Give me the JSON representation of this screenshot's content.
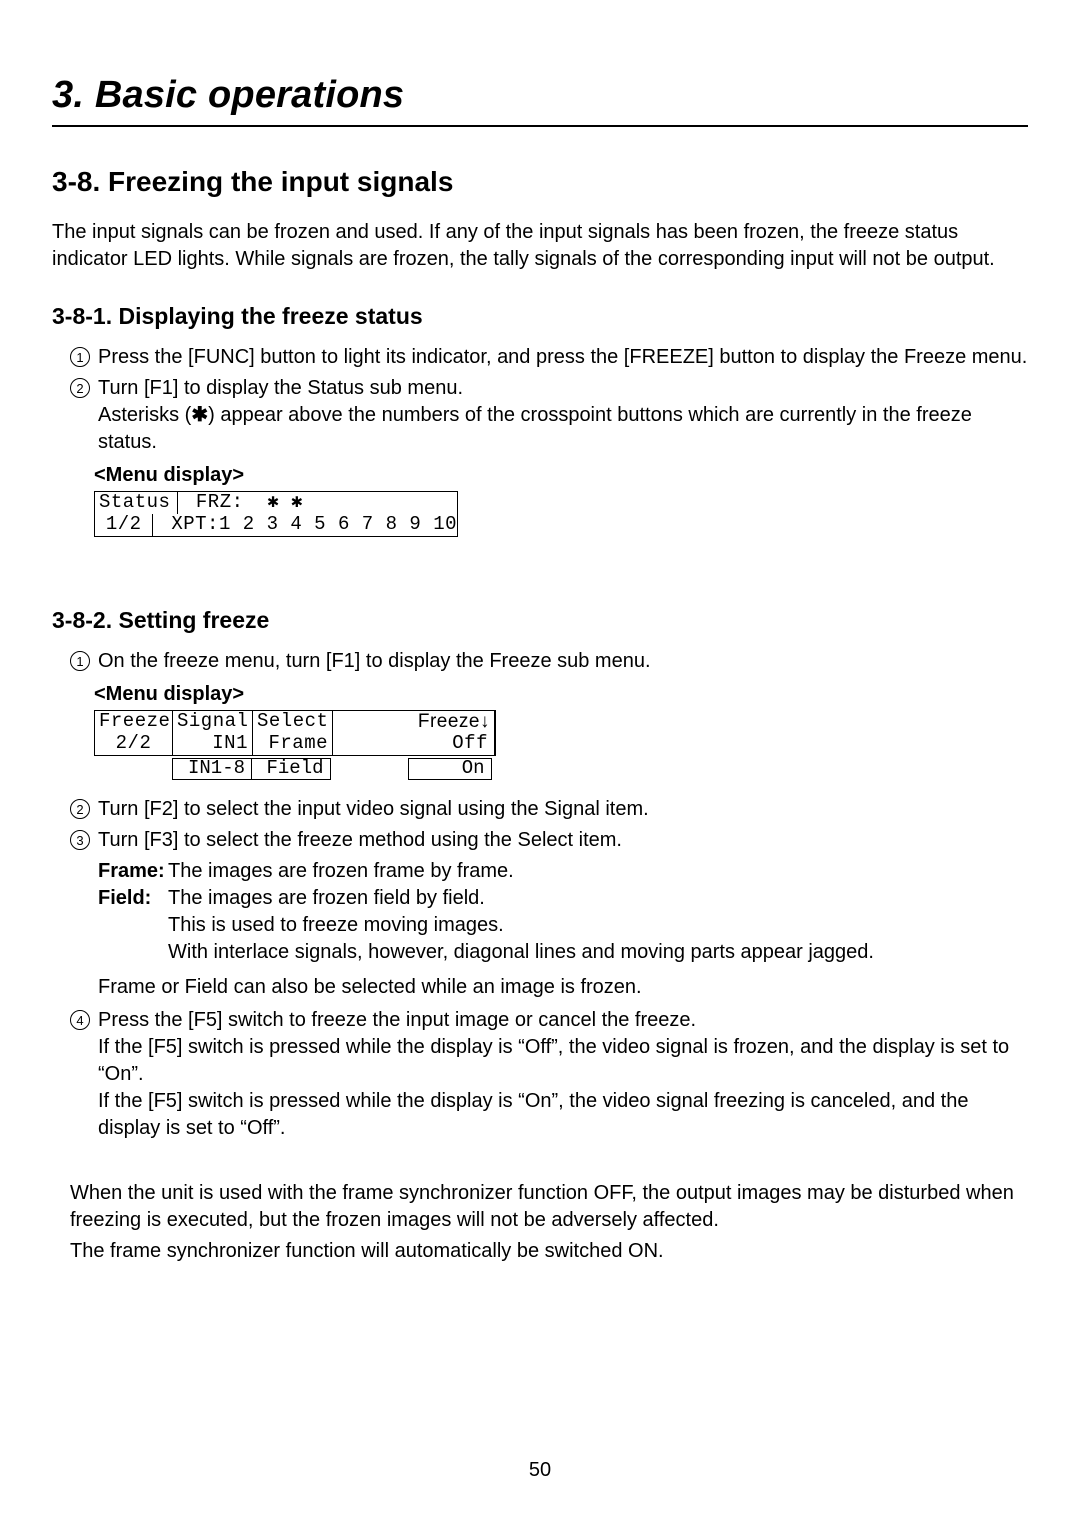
{
  "chapter_title": "3. Basic operations",
  "section_title": "3-8. Freezing the input signals",
  "intro_p1": "The input signals can be frozen and used. If any of the input signals has been frozen, the freeze status indicator LED lights. While signals are frozen, the tally signals of the corresponding input will not be output.",
  "sub1_title": "3-8-1. Displaying the freeze status",
  "sub1_step1": "Press the [FUNC] button to light its indicator, and press the [FREEZE] button to display the Freeze menu.",
  "sub1_step2a": "Turn [F1] to display the Status sub menu.",
  "sub1_step2b_pre": "Asterisks (",
  "sub1_step2b_ast": "✱",
  "sub1_step2b_post": ") appear above the numbers of the crosspoint buttons which are currently in the freeze status.",
  "menu_display_label": "<Menu display>",
  "menu1": {
    "r1_left": "Status",
    "r1_right": " FRZ:  ✱ ✱",
    "r2_left": "1/2",
    "r2_right": " XPT:1 2 3 4 5 6 7 8 9 10"
  },
  "sub2_title": "3-8-2. Setting freeze",
  "sub2_step1": "On the freeze menu, turn [F1] to display the Freeze sub menu.",
  "menu2": {
    "h_c1": "Freeze",
    "h_c2": "Signal",
    "h_c3": "Select",
    "h_c4": "Freeze↓",
    "v_c1": "2/2",
    "v_c2": "IN1",
    "v_c3": "Frame",
    "v_c4": "Off",
    "o_sig": "IN1-8",
    "o_sel": "Field",
    "o_frz": "On"
  },
  "sub2_step2": "Turn [F2] to select the input video signal using the Signal item.",
  "sub2_step3": "Turn [F3] to select the freeze method using the Select item.",
  "def_frame_term": "Frame:",
  "def_frame_def": "The images are frozen frame by frame.",
  "def_field_term": "Field:",
  "def_field_def1": "The images are frozen field by field.",
  "def_field_def2": "This is used to freeze moving images.",
  "def_field_def3": "With interlace signals, however, diagonal lines and moving parts appear jagged.",
  "sub2_note1": "Frame or Field can also be selected while an image is frozen.",
  "sub2_step4a": "Press the [F5] switch to freeze the input image or cancel the freeze.",
  "sub2_step4b": "If the [F5] switch is pressed while the display is “Off”, the video signal is frozen, and the display is set to “On”.",
  "sub2_step4c": "If the [F5] switch is pressed while the display is “On”, the video signal freezing is canceled, and the display is set to “Off”.",
  "closing_p1": "When the unit is used with the frame synchronizer function OFF, the output images may be disturbed when freezing is executed, but the frozen images will not be adversely affected.",
  "closing_p2": "The frame synchronizer function will automatically be switched ON.",
  "page_number": "50"
}
